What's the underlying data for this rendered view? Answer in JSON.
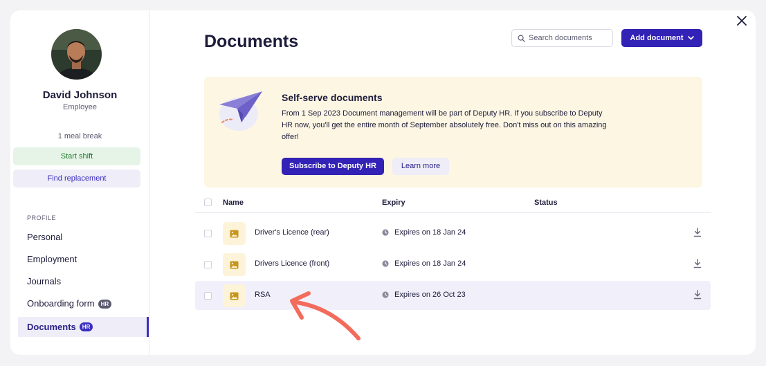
{
  "modal": {
    "close_icon": "close-icon"
  },
  "sidebar": {
    "user": {
      "name": "David Johnson",
      "role": "Employee"
    },
    "meal_break": "1 meal break",
    "start_shift_label": "Start shift",
    "find_replacement_label": "Find replacement",
    "section_label": "PROFILE",
    "nav_items": [
      {
        "label": "Personal",
        "badge": ""
      },
      {
        "label": "Employment",
        "badge": ""
      },
      {
        "label": "Journals",
        "badge": ""
      },
      {
        "label": "Onboarding form",
        "badge": "HR"
      },
      {
        "label": "Documents",
        "badge": "HR",
        "active": true
      }
    ]
  },
  "main": {
    "title": "Documents",
    "search": {
      "placeholder": "Search documents",
      "value": "",
      "icon": "search-icon"
    },
    "add_document_label": "Add document",
    "promo": {
      "title": "Self-serve documents",
      "text": "From 1 Sep 2023 Document management will be part of Deputy HR. If you subscribe to Deputy HR now, you'll get the entire month of September absolutely free. Don't miss out on this amazing offer!",
      "subscribe_label": "Subscribe to Deputy HR",
      "learn_more_label": "Learn more",
      "illustration": "paper-plane-icon"
    },
    "table": {
      "columns": {
        "name": "Name",
        "expiry": "Expiry",
        "status": "Status"
      },
      "rows": [
        {
          "name": "Driver's Licence (rear)",
          "expiry": "Expires on 18 Jan 24",
          "status": ""
        },
        {
          "name": "Drivers Licence (front)",
          "expiry": "Expires on 18 Jan 24",
          "status": ""
        },
        {
          "name": "RSA",
          "expiry": "Expires on 26 Oct 23",
          "status": "",
          "highlighted": true
        }
      ]
    }
  },
  "colors": {
    "primary": "#3322b6",
    "promo_bg": "#fdf6e3",
    "success_bg": "#e6f4e8",
    "annotation_arrow": "#f26b5b"
  }
}
